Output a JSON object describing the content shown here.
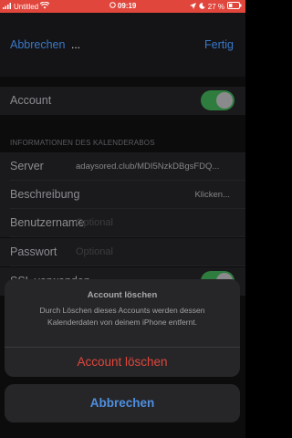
{
  "status_bar": {
    "carrier": "Untitled",
    "time": "09:19",
    "battery": "27 %"
  },
  "nav": {
    "cancel_label": "Abbrechen",
    "title": "...",
    "done_label": "Fertig"
  },
  "account_row": {
    "label": "Account",
    "toggle_on": true
  },
  "section_header": "INFORMATIONEN DES KALENDERABOS",
  "server_row": {
    "label": "Server",
    "value": "adaysored.club/MDI5NzkDBgsFDQ..."
  },
  "description_row": {
    "label": "Beschreibung",
    "value": "Klicken..."
  },
  "username_row": {
    "label": "Benutzername",
    "placeholder": "Optional"
  },
  "password_row": {
    "label": "Passwort",
    "placeholder": "Optional"
  },
  "ssl_row": {
    "label": "SSL verwenden",
    "toggle_on": true
  },
  "action_sheet": {
    "title": "Account löschen",
    "message": "Durch Löschen dieses Accounts werden dessen Kalenderdaten von deinem iPhone entfernt.",
    "delete_label": "Account löschen",
    "cancel_label": "Abbrechen"
  },
  "colors": {
    "status_bar_bg": "#e0463c",
    "accent_blue": "#3a78c9",
    "destructive_red": "#e0463c",
    "toggle_green": "#2e7d3e"
  }
}
